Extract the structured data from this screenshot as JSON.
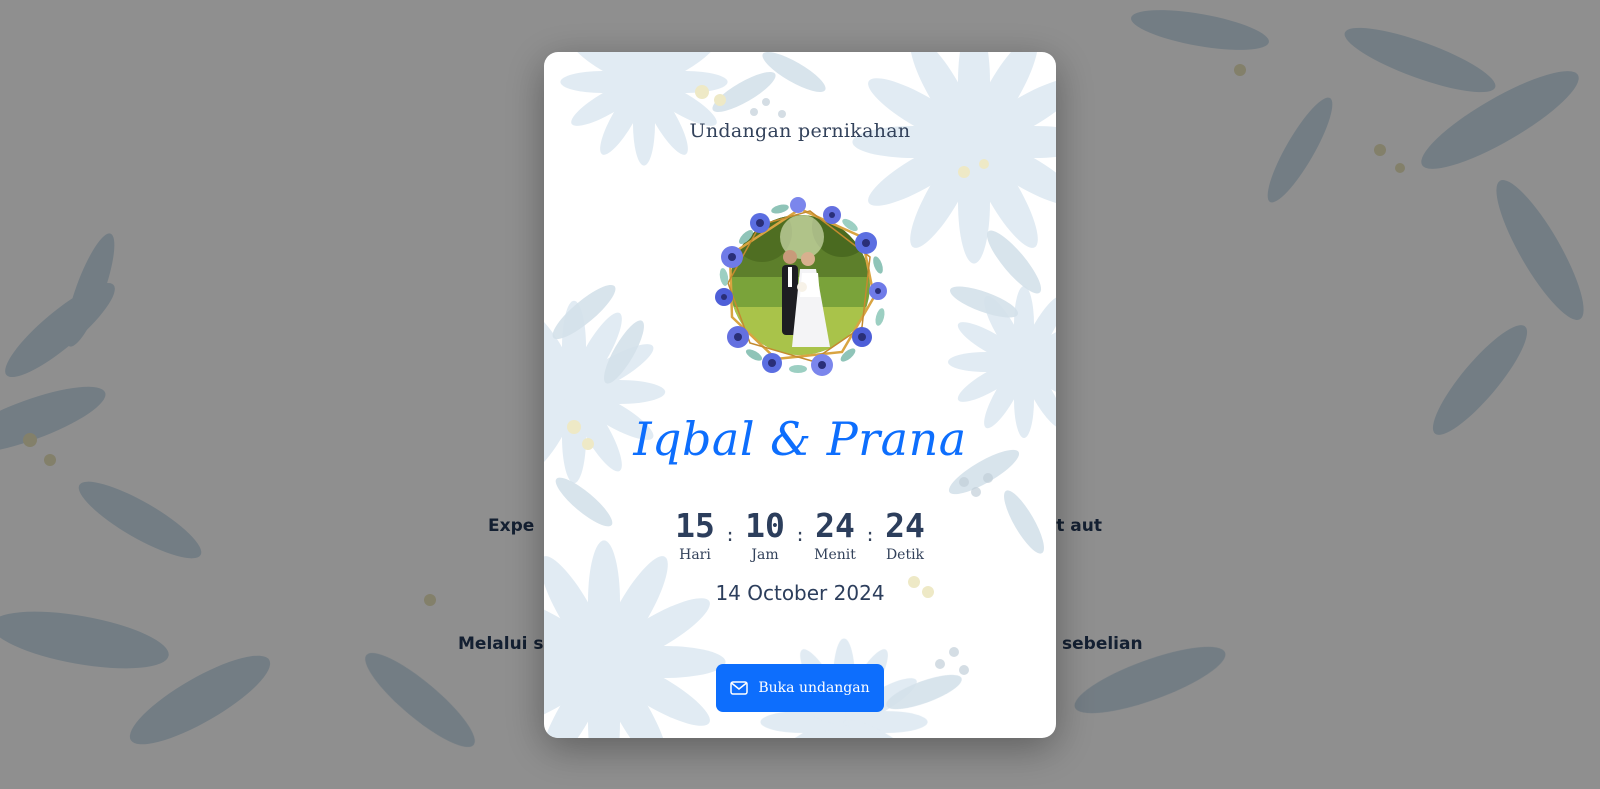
{
  "background": {
    "line_1_left": "Expe",
    "line_1_right": "nst aut",
    "line_2_left": "Melalui s",
    "line_2_right": "sebelian"
  },
  "card": {
    "title": "Undangan pernikahan",
    "couple_names": "Iqbal & Prana",
    "countdown": [
      {
        "value": "15",
        "label": "Hari"
      },
      {
        "value": "10",
        "label": "Jam"
      },
      {
        "value": "24",
        "label": "Menit"
      },
      {
        "value": "24",
        "label": "Detik"
      }
    ],
    "separator": ":",
    "event_date": "14 October 2024",
    "open_button_label": "Buka undangan",
    "open_button_icon": "envelope-icon"
  },
  "colors": {
    "accent": "#0d6efd",
    "text_dark": "#2c3e5c",
    "frame_gold": "#d9a441",
    "flower_blue": "#5b6ee1",
    "decor_blue": "#c9dcea"
  }
}
